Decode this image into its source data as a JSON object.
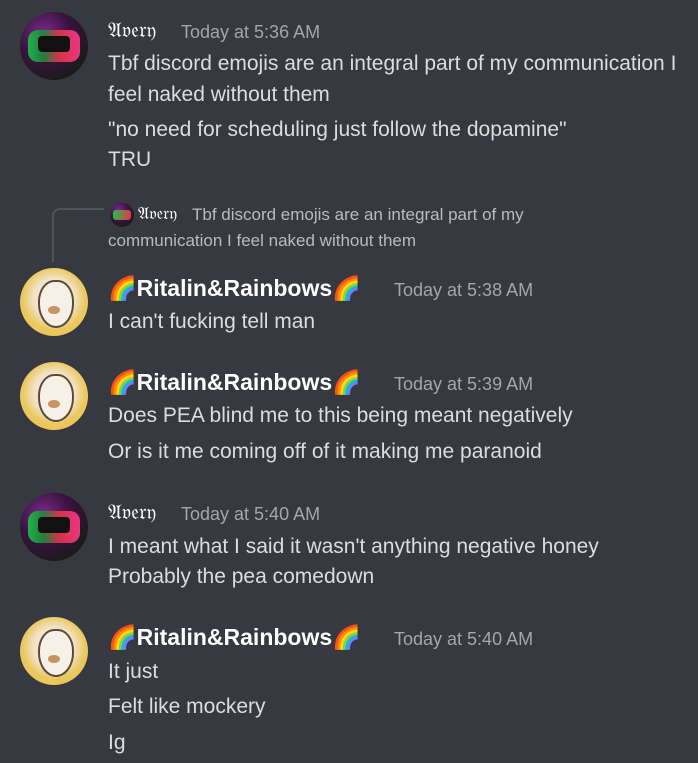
{
  "messages": [
    {
      "author": "𝔄𝔳𝔢𝔯𝔶",
      "time": "Today at 5:36 AM",
      "lines": [
        "Tbf discord emojis are an integral part of my communication I",
        "feel naked without them",
        "\"no need for scheduling just follow the dopamine\"",
        "TRU"
      ]
    },
    {
      "reply": {
        "author": "𝔄𝔳𝔢𝔯𝔶",
        "text_line1": "Tbf discord emojis are an integral part of my",
        "text_line2": "communication I feel naked without them"
      },
      "author": "Ritalin&Rainbows",
      "time": "Today at 5:38 AM",
      "lines": [
        "I can't fucking tell man"
      ]
    },
    {
      "author": "Ritalin&Rainbows",
      "time": "Today at 5:39 AM",
      "lines": [
        "Does PEA blind me to this being meant negatively",
        "Or is it me coming off of it making me paranoid"
      ]
    },
    {
      "author": "𝔄𝔳𝔢𝔯𝔶",
      "time": "Today at 5:40 AM",
      "lines": [
        "I meant what I said it wasn't anything negative honey",
        "Probably the pea comedown"
      ]
    },
    {
      "author": "Ritalin&Rainbows",
      "time": "Today at 5:40 AM",
      "lines": [
        "It just",
        "Felt like mockery",
        "Ig"
      ]
    }
  ],
  "icons": {
    "rainbow": "rainbow-emoji-icon"
  },
  "colors": {
    "background": "#36393f",
    "username": "#ffffff",
    "timestamp": "#a3a6aa",
    "text": "#dcddde"
  }
}
